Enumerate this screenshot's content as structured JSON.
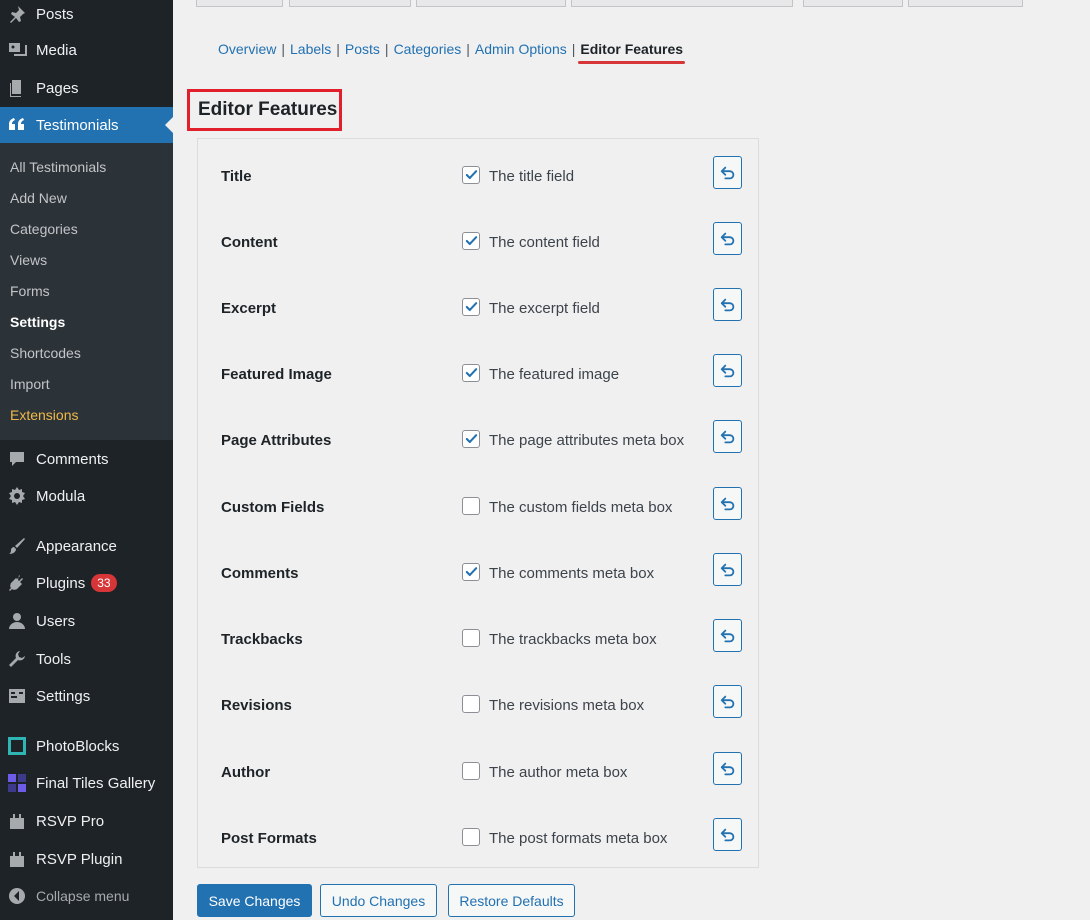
{
  "sidebar": {
    "top_items": [
      {
        "label": "Posts",
        "icon": "pin-icon"
      },
      {
        "label": "Media",
        "icon": "media-icon"
      },
      {
        "label": "Pages",
        "icon": "pages-icon"
      },
      {
        "label": "Testimonials",
        "icon": "quote-icon"
      }
    ],
    "submenu": [
      "All Testimonials",
      "Add New",
      "Categories",
      "Views",
      "Forms",
      "Settings",
      "Shortcodes",
      "Import",
      "Extensions"
    ],
    "bottom_items": [
      {
        "label": "Comments",
        "icon": "comments-icon"
      },
      {
        "label": "Modula",
        "icon": "gear-icon"
      },
      {
        "label": "Appearance",
        "icon": "brush-icon"
      },
      {
        "label": "Plugins",
        "icon": "plugin-icon",
        "badge": "33"
      },
      {
        "label": "Users",
        "icon": "user-icon"
      },
      {
        "label": "Tools",
        "icon": "wrench-icon"
      },
      {
        "label": "Settings",
        "icon": "settings-icon"
      },
      {
        "label": "PhotoBlocks",
        "icon": "photoblocks-icon"
      },
      {
        "label": "Final Tiles Gallery",
        "icon": "tiles-icon"
      },
      {
        "label": "RSVP Pro",
        "icon": "rsvp-icon"
      },
      {
        "label": "RSVP Plugin",
        "icon": "rsvp-icon"
      }
    ],
    "collapse_label": "Collapse menu"
  },
  "subnav": {
    "links": [
      "Overview",
      "Labels",
      "Posts",
      "Categories",
      "Admin Options"
    ],
    "current": "Editor Features"
  },
  "page_title": "Editor Features",
  "features": [
    {
      "label": "Title",
      "desc": "The title field",
      "checked": true
    },
    {
      "label": "Content",
      "desc": "The content field",
      "checked": true
    },
    {
      "label": "Excerpt",
      "desc": "The excerpt field",
      "checked": true
    },
    {
      "label": "Featured Image",
      "desc": "The featured image",
      "checked": true
    },
    {
      "label": "Page Attributes",
      "desc": "The page attributes meta box",
      "checked": true
    },
    {
      "label": "Custom Fields",
      "desc": "The custom fields meta box",
      "checked": false
    },
    {
      "label": "Comments",
      "desc": "The comments meta box",
      "checked": true
    },
    {
      "label": "Trackbacks",
      "desc": "The trackbacks meta box",
      "checked": false
    },
    {
      "label": "Revisions",
      "desc": "The revisions meta box",
      "checked": false
    },
    {
      "label": "Author",
      "desc": "The author meta box",
      "checked": false
    },
    {
      "label": "Post Formats",
      "desc": "The post formats meta box",
      "checked": false
    }
  ],
  "buttons": {
    "save": "Save Changes",
    "undo": "Undo Changes",
    "restore": "Restore Defaults"
  },
  "colors": {
    "accent": "#2271b1",
    "highlight": "#e2202b",
    "sidebar_bg": "#1d2327",
    "badge": "#d63638"
  }
}
